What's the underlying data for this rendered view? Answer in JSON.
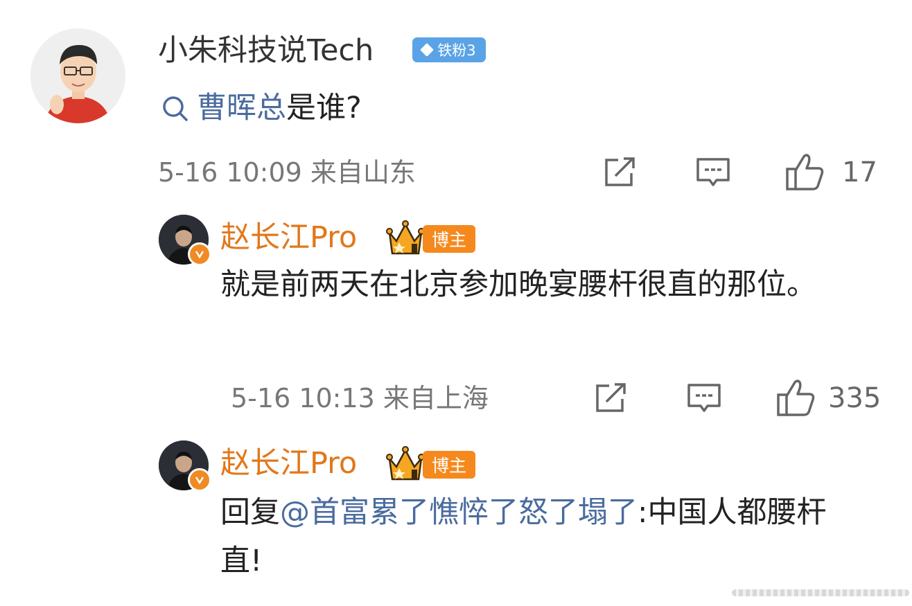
{
  "comment": {
    "user_name": "小朱科技说Tech",
    "fan_badge": "铁粉3",
    "topic": "曹晖总",
    "text_suffix": "是谁?",
    "meta": "5-16 10:09 来自山东",
    "likes": "17"
  },
  "replies": [
    {
      "user_name": "赵长江Pro",
      "badge": "博主",
      "text": "就是前两天在北京参加晚宴腰杆很直的那位。",
      "meta": "5-16 10:13 来自上海",
      "likes": "335"
    },
    {
      "user_name": "赵长江Pro",
      "badge": "博主",
      "text_prefix": "回复",
      "mention": "@首富累了憔悴了怒了塌了",
      "text_suffix": ":中国人都腰杆直!"
    }
  ],
  "icons": [
    "search-icon",
    "share-icon",
    "comment-icon",
    "like-icon",
    "verified-icon",
    "crown-icon",
    "diamond-icon"
  ],
  "colors": {
    "topic_link": "#4a6b9e",
    "blogger_name": "#e2771a",
    "blogger_badge": "#f5891e",
    "fan_badge": "#5aa3e6",
    "meta_text": "#777777"
  }
}
